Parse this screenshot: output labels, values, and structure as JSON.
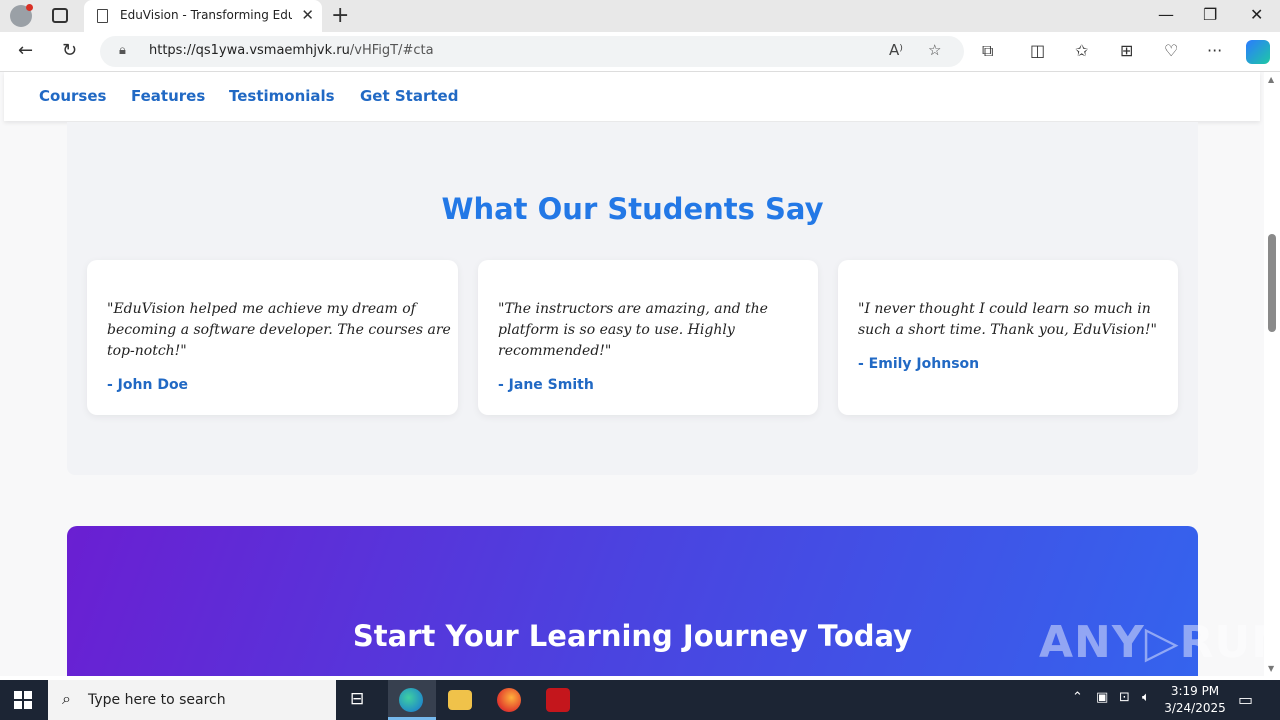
{
  "browser": {
    "tab_title": "EduVision - Transforming Educat",
    "tab_close": "✕",
    "new_tab": "+",
    "url_host": "https://qs1ywa.vsmaemhjvk.ru",
    "url_path": "/vHFigT/#cta"
  },
  "sitenav": {
    "items": [
      "Courses",
      "Features",
      "Testimonials",
      "Get Started"
    ]
  },
  "testimonials": {
    "heading": "What Our Students Say",
    "cards": [
      {
        "quote_lines": [
          "\"EduVision helped me achieve my dream of",
          "becoming a software developer. The courses are",
          "top-notch!\""
        ],
        "author": "- John Doe"
      },
      {
        "quote_lines": [
          "\"The instructors are amazing, and the",
          "platform is so easy to use. Highly",
          "recommended!\""
        ],
        "author": "- Jane Smith"
      },
      {
        "quote_lines": [
          "\"I never thought I could learn so much in",
          "such a short time. Thank you, EduVision!\""
        ],
        "author": "- Emily Johnson"
      }
    ]
  },
  "cta": {
    "heading": "Start Your Learning Journey Today"
  },
  "watermark": "ANY▷RUN",
  "taskbar": {
    "search_placeholder": "Type here to search",
    "time": "3:19 PM",
    "date": "3/24/2025"
  },
  "colors": {
    "accent": "#2378e6",
    "link": "#2169c4",
    "cta_start": "#6a1fd2",
    "cta_end": "#3464ee"
  },
  "icons": {
    "browser": [
      "profile-icon",
      "tab-actions-icon",
      "page-icon",
      "close-icon",
      "new-tab-icon",
      "minimize-icon",
      "maximize-icon",
      "window-close-icon",
      "back-icon",
      "refresh-icon",
      "lock-icon",
      "read-aloud-icon",
      "favorite-icon",
      "extensions-icon",
      "split-screen-icon",
      "favorites-icon",
      "collections-icon",
      "performance-icon",
      "more-icon",
      "copilot-icon"
    ],
    "taskbar": [
      "windows-start-icon",
      "search-icon",
      "task-view-icon",
      "edge-icon",
      "file-explorer-icon",
      "firefox-icon",
      "acrobat-icon",
      "chevron-up-icon",
      "network-icon",
      "volume-icon",
      "notification-icon"
    ]
  }
}
